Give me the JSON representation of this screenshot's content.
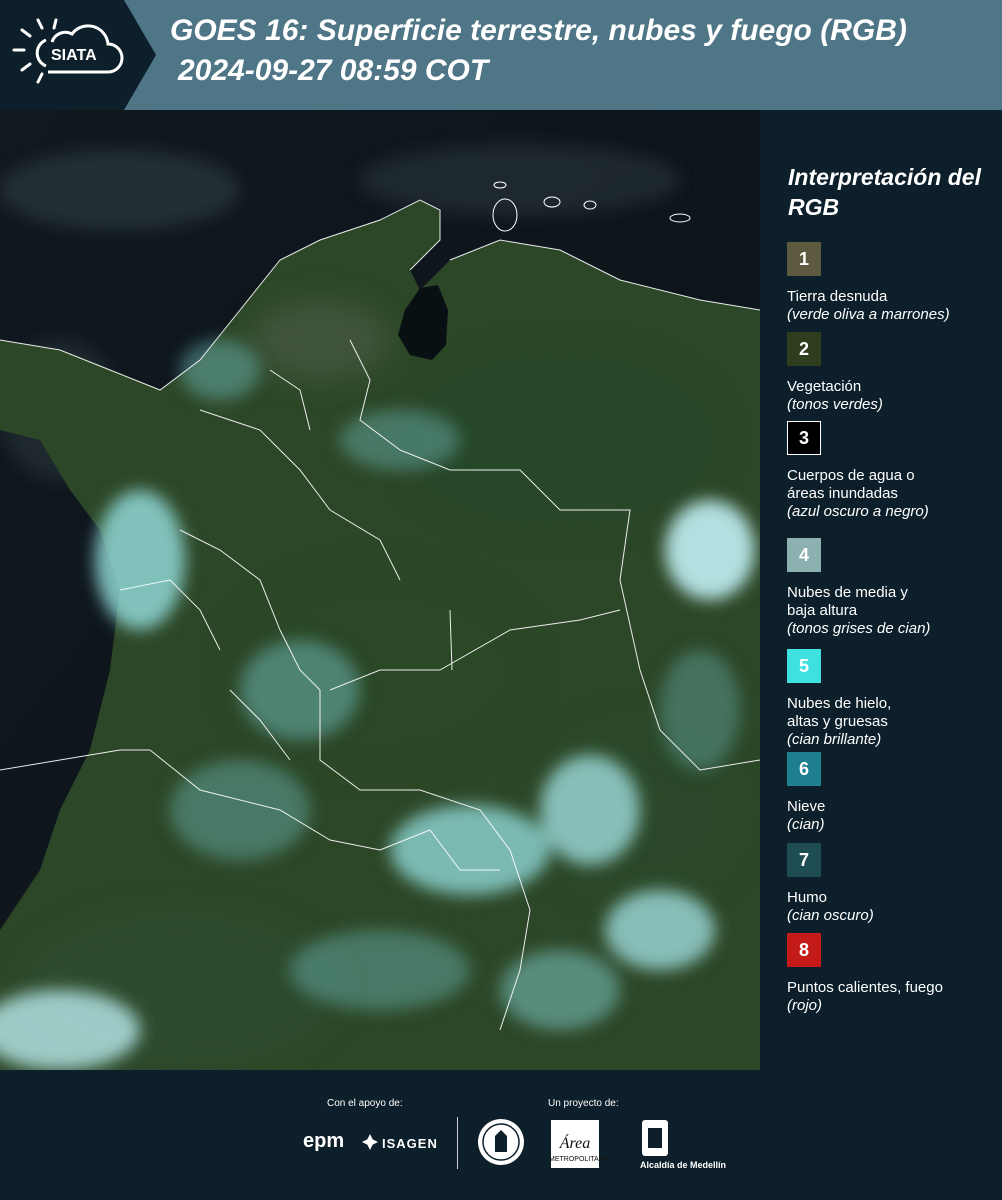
{
  "header": {
    "logo_text": "SIATA",
    "title_line1": "GOES 16: Superficie terrestre, nubes y fuego (RGB)",
    "title_line2": "2024-09-27 08:59 COT"
  },
  "legend": {
    "title": "Interpretación del RGB",
    "items": [
      {
        "number": "1",
        "label": "Tierra desnuda",
        "desc": "(verde oliva a marrones)",
        "color": "#5d5a3f"
      },
      {
        "number": "2",
        "label": "Vegetación",
        "desc": "(tonos verdes)",
        "color": "#2e3e1f"
      },
      {
        "number": "3",
        "label": "Cuerpos de agua o áreas inundadas",
        "desc": "(azul oscuro a negro)",
        "color": "#000000"
      },
      {
        "number": "4",
        "label": "Nubes de media y baja altura",
        "desc": "(tonos grises de cian)",
        "color": "#8bb1b1"
      },
      {
        "number": "5",
        "label": "Nubes de hielo, altas y gruesas",
        "desc": "(cian brillante)",
        "color": "#3fe0e0"
      },
      {
        "number": "6",
        "label": "Nieve",
        "desc": "(cian)",
        "color": "#1e7f91"
      },
      {
        "number": "7",
        "label": "Humo",
        "desc": "(cian oscuro)",
        "color": "#1f4d54"
      },
      {
        "number": "8",
        "label": "Puntos calientes, fuego",
        "desc": "(rojo)",
        "color": "#c41a1a"
      }
    ]
  },
  "footer": {
    "support_caption": "Con el apoyo de:",
    "project_caption": "Un proyecto de:",
    "epm": "epm",
    "isagen": "ISAGEN",
    "area_logo": "Área",
    "area_sub": "METROPOLITANA",
    "alcaldia": "Alcaldía de Medellín"
  },
  "colors": {
    "header_bg": "#4f7686",
    "page_bg": "#0d1f2a",
    "vegetation": "#2f4a2a",
    "cloud": "#8fd7d6",
    "ocean": "#0b141a"
  }
}
